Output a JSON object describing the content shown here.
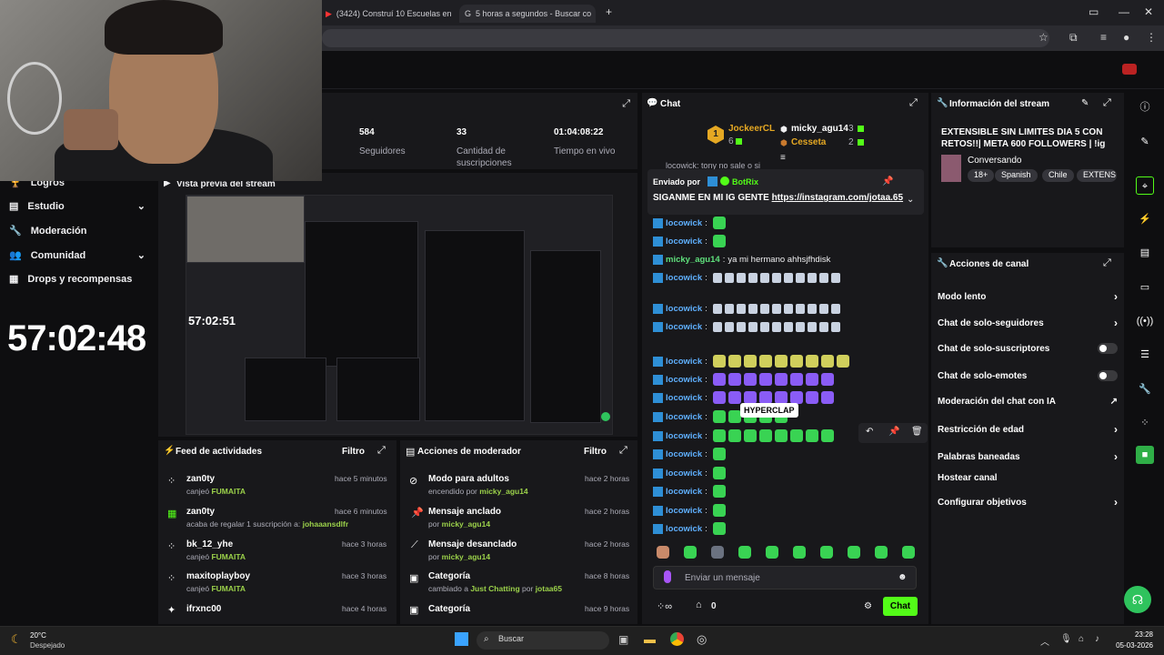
{
  "browser": {
    "tabs": [
      {
        "label": "(3424) Construí 10 Escuelas en",
        "active": false
      },
      {
        "label": "5 horas a segundos - Buscar co",
        "active": true
      }
    ]
  },
  "sidebar": {
    "items": [
      {
        "label": "Logros",
        "icon": "trophy-icon"
      },
      {
        "label": "Estudio",
        "icon": "book-icon",
        "chevron": true
      },
      {
        "label": "Moderación",
        "icon": "wrench-icon"
      },
      {
        "label": "Comunidad",
        "icon": "people-icon",
        "chevron": true
      },
      {
        "label": "Drops y recompensas",
        "icon": "grid-icon"
      }
    ],
    "timer": "57:02:48"
  },
  "stats": {
    "followers_value": "584",
    "followers_label": "Seguidores",
    "subs_value": "33",
    "subs_label": "Cantidad de suscripciones",
    "live_value": "01:04:08:22",
    "live_label": "Tiempo en vivo"
  },
  "preview": {
    "title": "Vista previa del stream",
    "inner_timer": "57:02:51"
  },
  "feed": {
    "title": "Feed de actividades",
    "filter": "Filtro",
    "items": [
      {
        "name": "zan0ty",
        "sub_prefix": "canjeó",
        "sub_value": "FUMAITA",
        "time": "hace 5 minutos",
        "icon": "points-icon"
      },
      {
        "name": "zan0ty",
        "sub_prefix": "acaba de regalar 1 suscripción a:",
        "sub_value": "johaaansdlfr",
        "time": "hace 6 minutos",
        "icon": "gift-icon"
      },
      {
        "name": "bk_12_yhe",
        "sub_prefix": "canjeó",
        "sub_value": "FUMAITA",
        "time": "hace 3 horas",
        "icon": "points-icon"
      },
      {
        "name": "maxitoplayboy",
        "sub_prefix": "canjeó",
        "sub_value": "FUMAITA",
        "time": "hace 3 horas",
        "icon": "points-icon"
      },
      {
        "name": "ifrxnc00",
        "sub_prefix": "",
        "sub_value": "",
        "time": "hace 4 horas",
        "icon": "sparkle-icon"
      }
    ]
  },
  "modactions": {
    "title": "Acciones de moderador",
    "filter": "Filtro",
    "items": [
      {
        "name": "Modo para adultos",
        "sub_prefix": "encendido por",
        "sub_value": "micky_agu14",
        "time": "hace 2 horas",
        "icon": "eye-off-icon"
      },
      {
        "name": "Mensaje anclado",
        "sub_prefix": "por",
        "sub_value": "micky_agu14",
        "time": "hace 2 horas",
        "icon": "pin-icon"
      },
      {
        "name": "Mensaje desanclado",
        "sub_prefix": "por",
        "sub_value": "micky_agu14",
        "time": "hace 2 horas",
        "icon": "unpin-icon"
      },
      {
        "name": "Categoría",
        "sub_prefix": "cambiado a",
        "sub_value": "Just Chatting",
        "sub_suffix": "por",
        "sub_value2": "jotaa65",
        "time": "hace 8 horas",
        "icon": "category-icon"
      },
      {
        "name": "Categoría",
        "sub_prefix": "",
        "sub_value": "",
        "time": "hace 9 horas",
        "icon": "category-icon"
      }
    ]
  },
  "chat": {
    "title": "Chat",
    "leaderboard": {
      "first_name": "JockeerCL",
      "first_count": "6",
      "first_rank": "1",
      "second_name": "micky_agu14",
      "second_count": "3",
      "third_name": "Cesseta",
      "third_count": "2"
    },
    "top_partial": "locowick: tony no sale o si",
    "pinned_by_label": "Enviado por",
    "pinned_by": "BotRix",
    "pinned_text": "SIGANME EN MI IG GENTE ",
    "pinned_link": "https://instagram.com/jotaa.65",
    "messages": [
      {
        "user": "locowick",
        "text": ""
      },
      {
        "user": "locowick",
        "text": ""
      },
      {
        "user": "micky_agu14",
        "text": "ya mi hermano ahhsjfhdisk"
      },
      {
        "user": "locowick",
        "text": ""
      },
      {
        "user": "locowick",
        "text": ""
      },
      {
        "user": "locowick",
        "text": ""
      },
      {
        "user": "locowick",
        "text": ""
      },
      {
        "user": "locowick",
        "text": ""
      },
      {
        "user": "locowick",
        "text": ""
      },
      {
        "user": "locowick",
        "text": ""
      },
      {
        "user": "locowick",
        "text": ""
      },
      {
        "user": "locowick",
        "text": ""
      },
      {
        "user": "locowick",
        "text": ""
      },
      {
        "user": "locowick",
        "text": ""
      },
      {
        "user": "locowick",
        "text": ""
      },
      {
        "user": "locowick",
        "text": ""
      }
    ],
    "tooltip": "HYPERCLAP",
    "input_placeholder": "Enviar un mensaje",
    "points": "0",
    "send_label": "Chat"
  },
  "info": {
    "title": "Información del stream",
    "stream_title": "EXTENSIBLE SIN LIMITES DIA 5 CON RETOS!!| META 600 FOLLOWERS | !ig !d...",
    "category": "Conversando",
    "tags": [
      "18+",
      "Spanish",
      "Chile",
      "EXTENS"
    ]
  },
  "actions": {
    "title": "Acciones de canal",
    "items": [
      {
        "label": "Modo lento",
        "control": "chevron"
      },
      {
        "label": "Chat de solo-seguidores",
        "control": "chevron"
      },
      {
        "label": "Chat de solo-suscriptores",
        "control": "toggle"
      },
      {
        "label": "Chat de solo-emotes",
        "control": "toggle"
      },
      {
        "label": "Moderación del chat con IA",
        "control": "external"
      },
      {
        "label": "Restricción de edad",
        "control": "chevron"
      },
      {
        "label": "Palabras baneadas",
        "control": "chevron"
      },
      {
        "label": "Hostear canal",
        "control": "none"
      },
      {
        "label": "Configurar objetivos",
        "control": "chevron"
      }
    ]
  },
  "taskbar": {
    "weather_temp": "20°C",
    "weather_desc": "Despejado",
    "search": "Buscar",
    "time": "23:28",
    "date": "05-03-2026"
  },
  "colors": {
    "accent": "#53fc18",
    "bg": "#0e0e10",
    "panel": "#18181b",
    "link": "#9bd14a"
  }
}
